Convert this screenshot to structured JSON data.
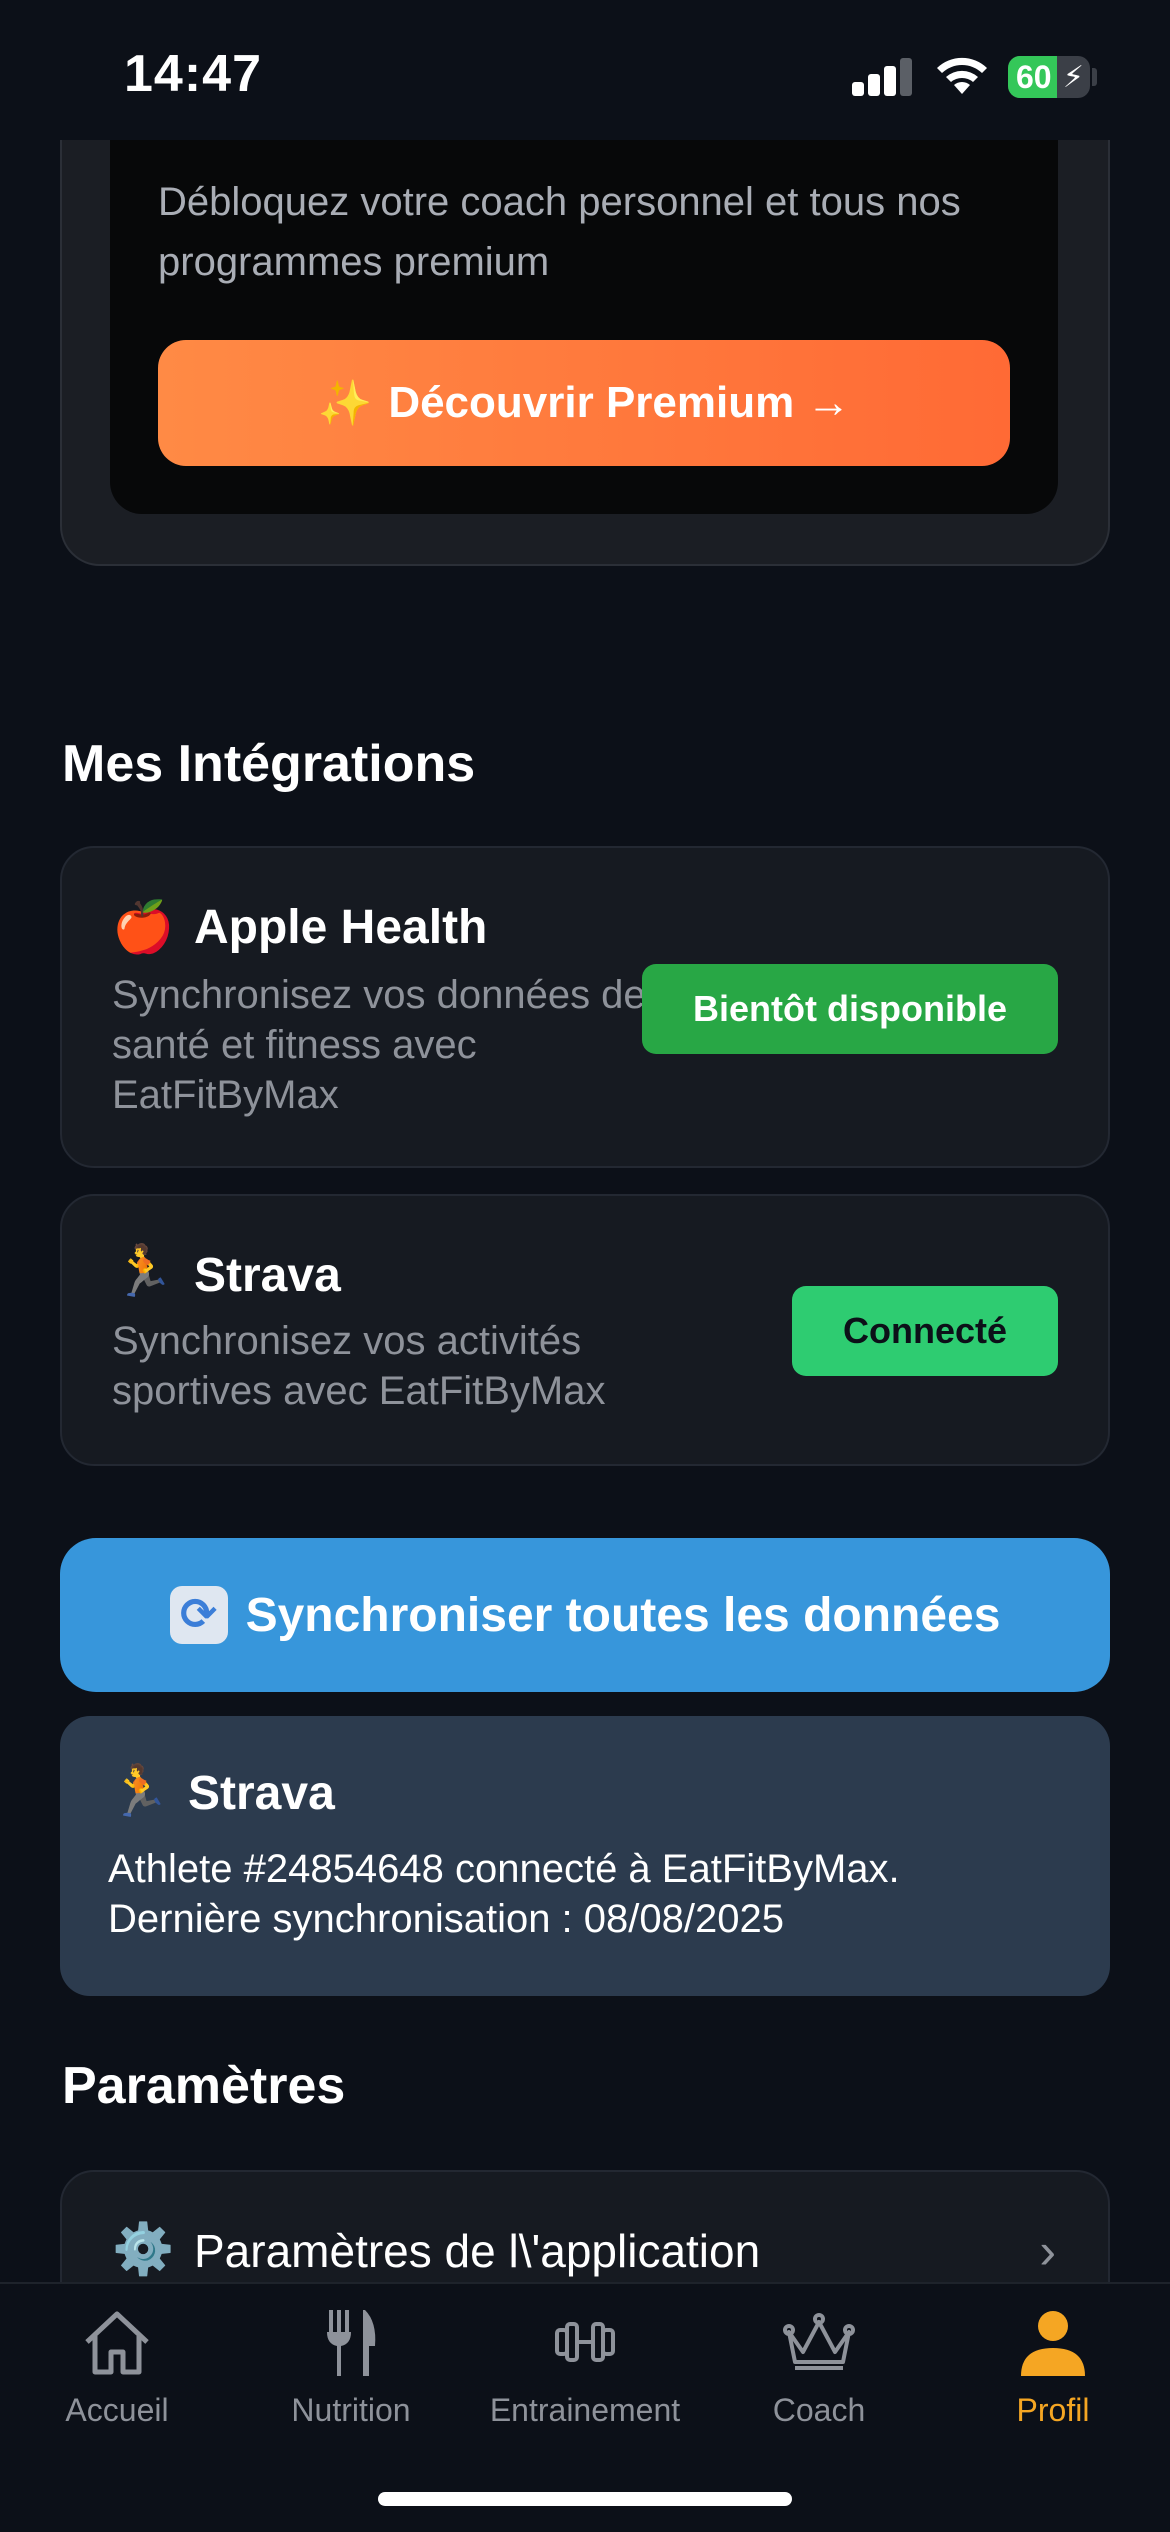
{
  "status_bar": {
    "time": "14:47",
    "battery_level": "60",
    "icons": [
      "signal-icon",
      "wifi-icon",
      "battery-charging-icon"
    ]
  },
  "premium": {
    "description": "Débloquez votre coach personnel et tous nos programmes premium",
    "button_icon": "✨",
    "button_label": "Découvrir Premium →"
  },
  "integrations": {
    "title": "Mes Intégrations",
    "items": [
      {
        "icon": "🍎",
        "name": "Apple Health",
        "description": "Synchronisez vos données de santé et fitness avec EatFitByMax",
        "status": "Bientôt disponible",
        "status_color": "#28a745"
      },
      {
        "icon": "🏃",
        "name": "Strava",
        "description": "Synchronisez vos activités sportives avec EatFitByMax",
        "status": "Connecté",
        "status_color": "#2ecc71"
      }
    ],
    "sync_button_icon": "🔄",
    "sync_button_label": "Synchroniser toutes les données"
  },
  "strava_info": {
    "icon": "🏃",
    "title": "Strava",
    "line1": "Athlete #24854648 connecté à EatFitByMax.",
    "line2": "Dernière synchronisation : 08/08/2025"
  },
  "settings": {
    "title": "Paramètres",
    "item_icon": "⚙️",
    "item_label": "Paramètres de l\\'application",
    "item_chevron": "›"
  },
  "tab_bar": {
    "tabs": [
      {
        "label": "Accueil",
        "icon": "home-icon",
        "active": false
      },
      {
        "label": "Nutrition",
        "icon": "fork-knife-icon",
        "active": false
      },
      {
        "label": "Entrainement",
        "icon": "dumbbell-icon",
        "active": false
      },
      {
        "label": "Coach",
        "icon": "crown-icon",
        "active": false
      },
      {
        "label": "Profil",
        "icon": "person-icon",
        "active": true
      }
    ],
    "active_color": "#f5a623",
    "inactive_color": "#8e929a"
  }
}
